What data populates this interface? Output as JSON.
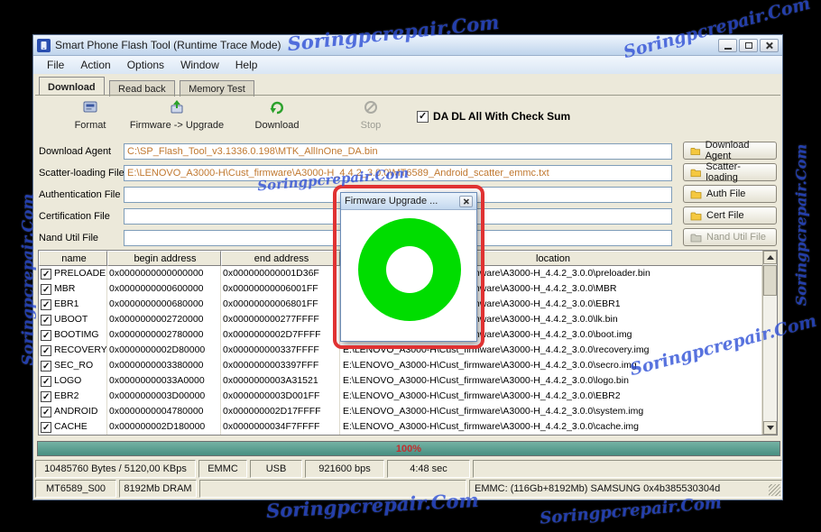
{
  "watermark": {
    "text": "Soringpcrepair.Com",
    "color": "#2e4fd6"
  },
  "window": {
    "title": "Smart Phone Flash Tool (Runtime Trace Mode)",
    "menu": [
      "File",
      "Action",
      "Options",
      "Window",
      "Help"
    ],
    "tabs": [
      "Download",
      "Read back",
      "Memory Test"
    ]
  },
  "toolbar": {
    "format": "Format",
    "firmware_upgrade": "Firmware -> Upgrade",
    "download": "Download",
    "stop": "Stop",
    "da_dl_checkbox": "DA DL All With Check Sum",
    "da_dl_checked": true
  },
  "fields": [
    {
      "label": "Download Agent",
      "value": "C:\\SP_Flash_Tool_v3.1336.0.198\\MTK_AllInOne_DA.bin"
    },
    {
      "label": "Scatter-loading File",
      "value": "E:\\LENOVO_A3000-H\\Cust_firmware\\A3000-H_4.4.2_3.0.0\\MT6589_Android_scatter_emmc.txt"
    },
    {
      "label": "Authentication File",
      "value": ""
    },
    {
      "label": "Certification File",
      "value": ""
    },
    {
      "label": "Nand Util File",
      "value": ""
    }
  ],
  "side_buttons": [
    {
      "label": "Download Agent",
      "disabled": false
    },
    {
      "label": "Scatter-loading",
      "disabled": false
    },
    {
      "label": "Auth File",
      "disabled": false
    },
    {
      "label": "Cert File",
      "disabled": false
    },
    {
      "label": "Nand Util File",
      "disabled": true
    }
  ],
  "table": {
    "headers": [
      "name",
      "begin address",
      "end address",
      "location"
    ],
    "rows": [
      {
        "checked": true,
        "name": "PRELOADER",
        "begin": "0x0000000000000000",
        "end": "0x000000000001D36F",
        "location": "E:\\LENOVO_A3000-H\\Cust_firmware\\A3000-H_4.4.2_3.0.0\\preloader.bin"
      },
      {
        "checked": true,
        "name": "MBR",
        "begin": "0x0000000000600000",
        "end": "0x00000000006001FF",
        "location": "E:\\LENOVO_A3000-H\\Cust_firmware\\A3000-H_4.4.2_3.0.0\\MBR"
      },
      {
        "checked": true,
        "name": "EBR1",
        "begin": "0x0000000000680000",
        "end": "0x00000000006801FF",
        "location": "E:\\LENOVO_A3000-H\\Cust_firmware\\A3000-H_4.4.2_3.0.0\\EBR1"
      },
      {
        "checked": true,
        "name": "UBOOT",
        "begin": "0x0000000002720000",
        "end": "0x000000000277FFFF",
        "location": "E:\\LENOVO_A3000-H\\Cust_firmware\\A3000-H_4.4.2_3.0.0\\lk.bin"
      },
      {
        "checked": true,
        "name": "BOOTIMG",
        "begin": "0x0000000002780000",
        "end": "0x0000000002D7FFFF",
        "location": "E:\\LENOVO_A3000-H\\Cust_firmware\\A3000-H_4.4.2_3.0.0\\boot.img"
      },
      {
        "checked": true,
        "name": "RECOVERY",
        "begin": "0x0000000002D80000",
        "end": "0x000000000337FFFF",
        "location": "E:\\LENOVO_A3000-H\\Cust_firmware\\A3000-H_4.4.2_3.0.0\\recovery.img"
      },
      {
        "checked": true,
        "name": "SEC_RO",
        "begin": "0x0000000003380000",
        "end": "0x0000000003397FFF",
        "location": "E:\\LENOVO_A3000-H\\Cust_firmware\\A3000-H_4.4.2_3.0.0\\secro.img"
      },
      {
        "checked": true,
        "name": "LOGO",
        "begin": "0x00000000033A0000",
        "end": "0x0000000003A31521",
        "location": "E:\\LENOVO_A3000-H\\Cust_firmware\\A3000-H_4.4.2_3.0.0\\logo.bin"
      },
      {
        "checked": true,
        "name": "EBR2",
        "begin": "0x0000000003D00000",
        "end": "0x0000000003D001FF",
        "location": "E:\\LENOVO_A3000-H\\Cust_firmware\\A3000-H_4.4.2_3.0.0\\EBR2"
      },
      {
        "checked": true,
        "name": "ANDROID",
        "begin": "0x0000000004780000",
        "end": "0x000000002D17FFFF",
        "location": "E:\\LENOVO_A3000-H\\Cust_firmware\\A3000-H_4.4.2_3.0.0\\system.img"
      },
      {
        "checked": true,
        "name": "CACHE",
        "begin": "0x000000002D180000",
        "end": "0x0000000034F7FFFF",
        "location": "E:\\LENOVO_A3000-H\\Cust_firmware\\A3000-H_4.4.2_3.0.0\\cache.img"
      }
    ]
  },
  "progress": {
    "percent_label": "100%"
  },
  "status_top": [
    "10485760 Bytes / 5120,00 KBps",
    "EMMC",
    "USB",
    "921600 bps",
    "4:48 sec"
  ],
  "status_bottom": [
    "MT6589_S00",
    "8192Mb DRAM",
    "EMMC: (116Gb+8192Mb) SAMSUNG 0x4b385530304d"
  ],
  "popup": {
    "title": "Firmware Upgrade ..."
  }
}
